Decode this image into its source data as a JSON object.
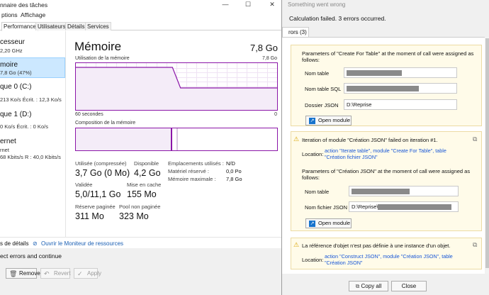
{
  "task_manager": {
    "title": "nnaire des tâches",
    "menu": [
      "ptions",
      "Affichage"
    ],
    "tabs": [
      "Performance",
      "Utilisateurs",
      "Détails",
      "Services"
    ],
    "sidebar": [
      {
        "name": "cesseur",
        "sub": "2,20 GHz"
      },
      {
        "name": "moire",
        "sub": "7,8 Go (47%)"
      },
      {
        "name": "que 0 (C:)",
        "sub": "213 Ko/s  Écrit. : 12,3 Ko/s"
      },
      {
        "name": "que 1 (D:)",
        "sub": "0 Ko/s  Écrit. : 0 Ko/s"
      },
      {
        "name": "ernet",
        "sub": "rnet",
        "sub2": "68 Kbits/s R : 40,0 Kbits/s"
      }
    ],
    "memory": {
      "title": "Mémoire",
      "total": "7,8 Go",
      "usage_label": "Utilisation de la mémoire",
      "usage_max": "7,8 Go",
      "x_left": "60 secondes",
      "x_right": "0",
      "composition_label": "Composition de la mémoire",
      "stats": {
        "used_label": "Utilisée (compressée)",
        "used_value": "3,7 Go (0 Mo)",
        "avail_label": "Disponible",
        "avail_value": "4,2 Go",
        "validated_label": "Validée",
        "validated_value": "5,0/11,1 Go",
        "cache_label": "Mise en cache",
        "cache_value": "155 Mo",
        "paged_label": "Réserve paginée",
        "paged_value": "311 Mo",
        "nonpaged_label": "Pool non paginée",
        "nonpaged_value": "323 Mo"
      },
      "details": [
        {
          "label": "Emplacements utilisés :",
          "value": "N/D"
        },
        {
          "label": "Matériel réservé :",
          "value": "0,0 Po"
        },
        {
          "label": "Mémoire maximale :",
          "value": "7,8 Go"
        }
      ],
      "usage_fraction": 0.47,
      "composition_used_fraction": 0.48
    },
    "footer": {
      "details": "s de détails",
      "monitor": "Ouvrir le Moniteur de ressources"
    }
  },
  "background_app": {
    "text": "ect errors and continue",
    "buttons": [
      "Remove",
      "Revert",
      "Apply"
    ]
  },
  "dialog": {
    "title": "Something went wrong",
    "message": "Calculation failed. 3 errors occurred.",
    "tab": "rors (3)",
    "errors": [
      {
        "params_title": "Parameters of \"Create For Table\" at the moment of call were assigned as follows:",
        "fields": [
          {
            "label": "Nom table",
            "value": ""
          },
          {
            "label": "Nom table SQL",
            "value": ""
          },
          {
            "label": "Dossier JSON",
            "value": "D:\\Reprise"
          }
        ],
        "open_label": "Open module"
      },
      {
        "message": "Iteration of module \"Création JSON\" failed on iteration #1.",
        "location_label": "Location:",
        "location_link": "action \"Iterate table\", module \"Create For Table\", table \"Création fichier JSON\"",
        "params_title": "Parameters of \"Création JSON\" at the moment of call were assigned as follows:",
        "fields": [
          {
            "label": "Nom table",
            "value": ""
          },
          {
            "label": "Nom fichier JSON",
            "value": "D:\\Reprise\\"
          }
        ],
        "open_label": "Open module"
      },
      {
        "message": "La référence d'objet n'est pas définie à une instance d'un objet.",
        "location_label": "Location:",
        "location_link": "action \"Construct JSON\", module \"Création JSON\", table \"Création JSON\""
      }
    ],
    "buttons": {
      "copy_all": "Copy all",
      "close": "Close"
    }
  }
}
